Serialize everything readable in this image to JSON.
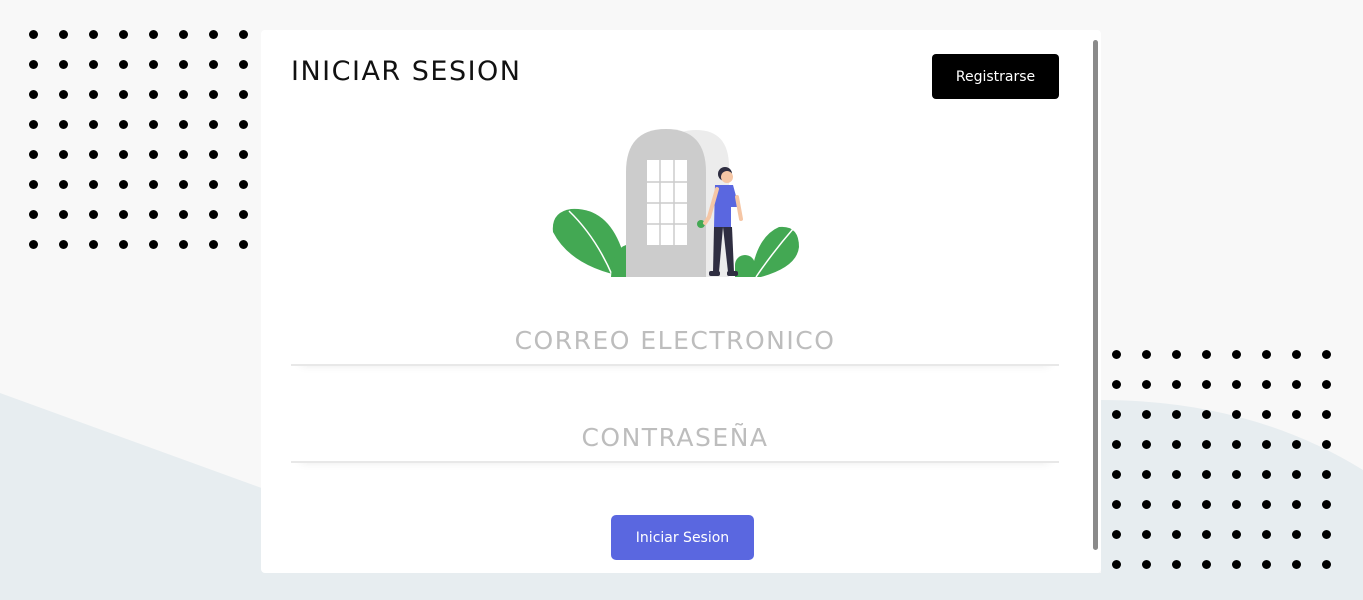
{
  "login": {
    "title": "INICIAR SESION",
    "register_label": "Registrarse",
    "email_placeholder": "CORREO ELECTRONICO",
    "password_placeholder": "CONTRASEÑA",
    "submit_label": "Iniciar Sesion"
  },
  "colors": {
    "background": "#f8f8f8",
    "wave": "#e7edf0",
    "card": "#ffffff",
    "register_button": "#000000",
    "login_button": "#5a67e0",
    "plant_green": "#43a853",
    "door_gray": "#cccccc",
    "person_shirt": "#5a67e0"
  },
  "illustration": {
    "icon": "person-opening-door-illustration"
  }
}
